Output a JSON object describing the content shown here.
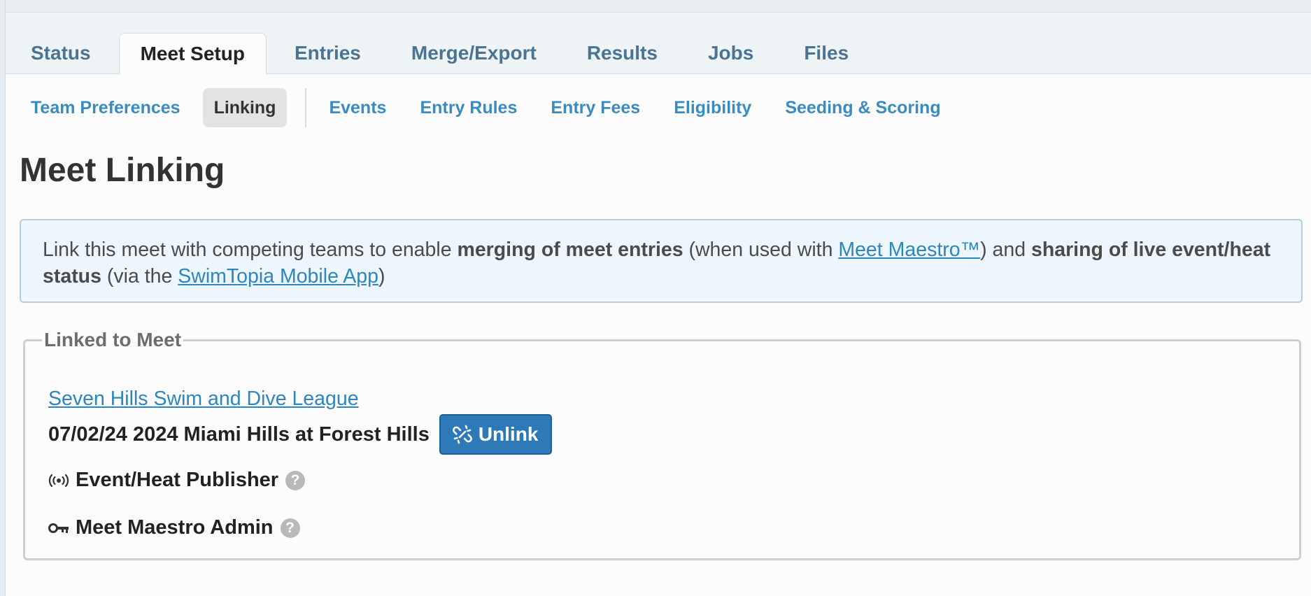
{
  "primary_tabs": [
    {
      "label": "Status"
    },
    {
      "label": "Meet Setup",
      "active": true
    },
    {
      "label": "Entries"
    },
    {
      "label": "Merge/Export"
    },
    {
      "label": "Results"
    },
    {
      "label": "Jobs"
    },
    {
      "label": "Files"
    }
  ],
  "sub_tabs": {
    "team_preferences": "Team Preferences",
    "linking": "Linking",
    "events": "Events",
    "entry_rules": "Entry Rules",
    "entry_fees": "Entry Fees",
    "eligibility": "Eligibility",
    "seeding_scoring": "Seeding & Scoring"
  },
  "page_title": "Meet Linking",
  "info": {
    "t1": "Link this meet with competing teams to enable ",
    "b1": "merging of meet entries",
    "t2": " (when used with ",
    "link1": "Meet Maestro™",
    "t3": ") and ",
    "b2": "sharing of live event/heat status",
    "t4": " (via the ",
    "link2": "SwimTopia Mobile App",
    "t5": ")"
  },
  "linked": {
    "legend": "Linked to Meet",
    "league": "Seven Hills Swim and Dive League",
    "meet": "07/02/24 2024 Miami Hills at Forest Hills",
    "unlink_label": "Unlink",
    "roles": [
      {
        "icon": "broadcast-icon",
        "label": "Event/Heat Publisher"
      },
      {
        "icon": "key-icon",
        "label": "Meet Maestro Admin"
      }
    ],
    "help_glyph": "?"
  },
  "colors": {
    "link": "#2e86bd",
    "tab_text": "#4a7491",
    "button": "#2e7ab8",
    "info_bg": "#ecf6fc"
  }
}
